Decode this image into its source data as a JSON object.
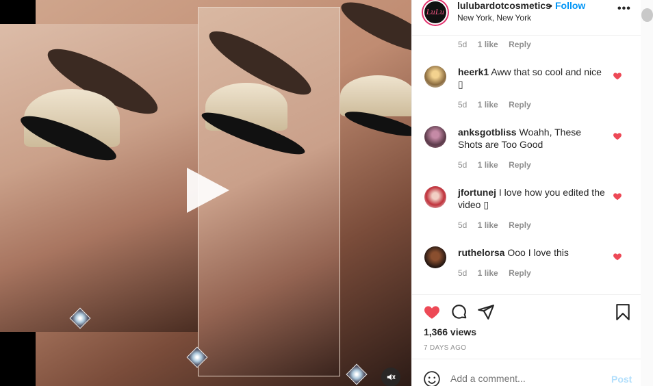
{
  "post": {
    "username": "lulubardotcosmetics",
    "dot": "•",
    "follow_label": "Follow",
    "location": "New York, New York",
    "avatar_text": "LuLu",
    "more_label": "•••"
  },
  "top_meta": {
    "age": "5d",
    "likes": "1 like",
    "reply": "Reply"
  },
  "comments": [
    {
      "user": "heerk1",
      "text": "Aww that so cool and nice ",
      "emoji": "▯",
      "age": "5d",
      "likes": "1 like",
      "reply": "Reply"
    },
    {
      "user": "anksgotbliss",
      "text": "Woahh, These Shots are Too Good",
      "emoji": "",
      "age": "5d",
      "likes": "1 like",
      "reply": "Reply"
    },
    {
      "user": "jfortunej",
      "text": "I love how you edited the video ",
      "emoji": "▯",
      "age": "5d",
      "likes": "1 like",
      "reply": "Reply"
    },
    {
      "user": "ruthelorsa",
      "text": "Ooo I love this",
      "emoji": "",
      "age": "5d",
      "likes": "1 like",
      "reply": "Reply"
    }
  ],
  "stats": {
    "views": "1,366 views",
    "ago": "7 DAYS AGO"
  },
  "composer": {
    "placeholder": "Add a comment...",
    "post_label": "Post"
  },
  "colors": {
    "like_red": "#ed4956",
    "link_blue": "#0095f6",
    "post_disabled": "#b2dffc",
    "text": "#262626",
    "muted": "#8e8e8e"
  },
  "icons": [
    "play-icon",
    "mute-icon",
    "heart-icon",
    "comment-icon",
    "share-icon",
    "bookmark-icon",
    "smiley-icon",
    "more-icon"
  ]
}
